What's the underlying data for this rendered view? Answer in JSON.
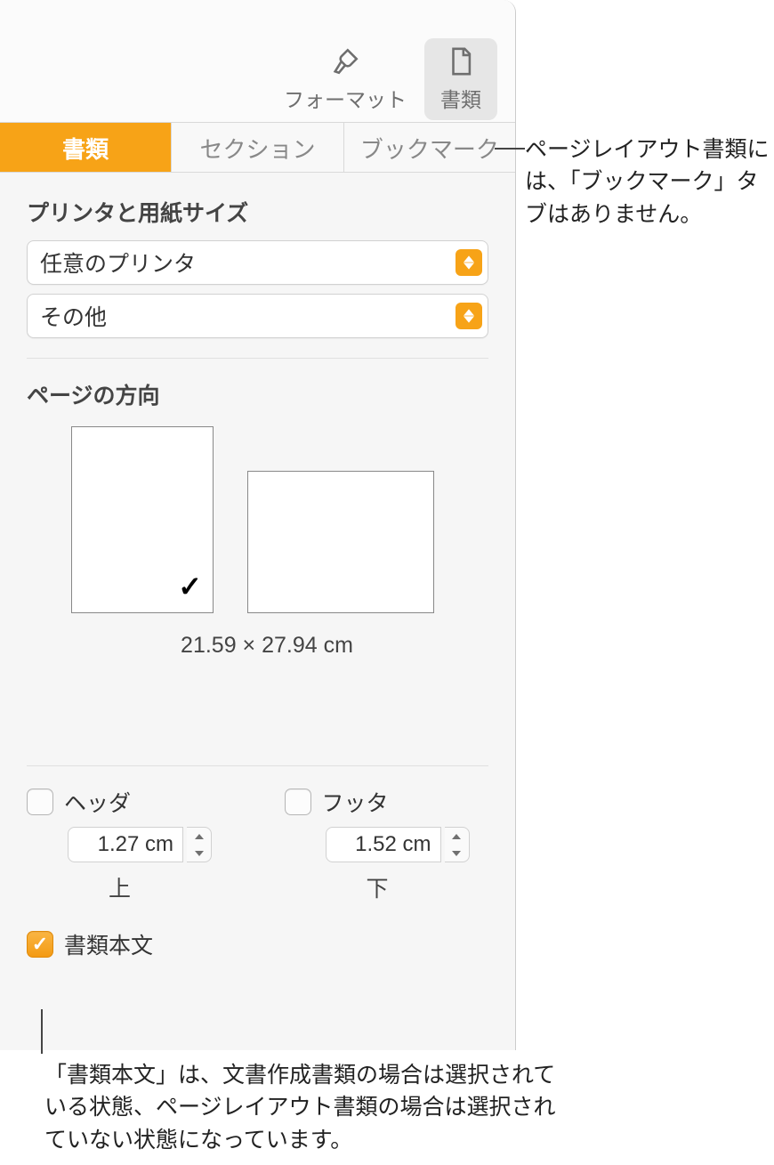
{
  "toolbar": {
    "format_label": "フォーマット",
    "document_label": "書類"
  },
  "tabs": {
    "document": "書類",
    "section": "セクション",
    "bookmark": "ブックマーク"
  },
  "printer_section": {
    "title": "プリンタと用紙サイズ",
    "printer_value": "任意のプリンタ",
    "paper_value": "その他"
  },
  "orientation": {
    "title": "ページの方向",
    "size_text": "21.59 × 27.94 cm"
  },
  "header_footer": {
    "header_label": "ヘッダ",
    "footer_label": "フッタ",
    "header_value": "1.27 cm",
    "footer_value": "1.52 cm",
    "top_label": "上",
    "bottom_label": "下"
  },
  "body_text": {
    "label": "書類本文"
  },
  "callouts": {
    "c1": "ページレイアウト書類には、「ブックマーク」タブはありません。",
    "c2": "「書類本文」は、文書作成書類の場合は選択されている状態、ページレイアウト書類の場合は選択されていない状態になっています。"
  }
}
